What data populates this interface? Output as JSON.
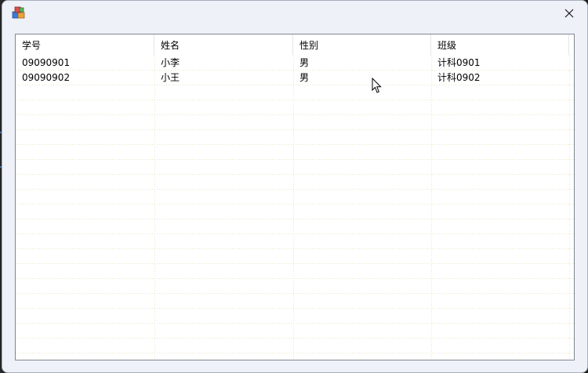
{
  "window": {
    "icon": "app-blocks-icon",
    "close_icon": "close-icon"
  },
  "listview": {
    "columns": [
      "学号",
      "姓名",
      "性别",
      "班级"
    ],
    "rows": [
      [
        "09090901",
        "小李",
        "男",
        "计科0901"
      ],
      [
        "09090902",
        "小王",
        "男",
        "计科0902"
      ]
    ]
  },
  "colors": {
    "gridline": "#ece6c8",
    "header_bg": "#ffffff",
    "window_bg": "#eef1f7",
    "close_hover": "#c42b1c"
  }
}
